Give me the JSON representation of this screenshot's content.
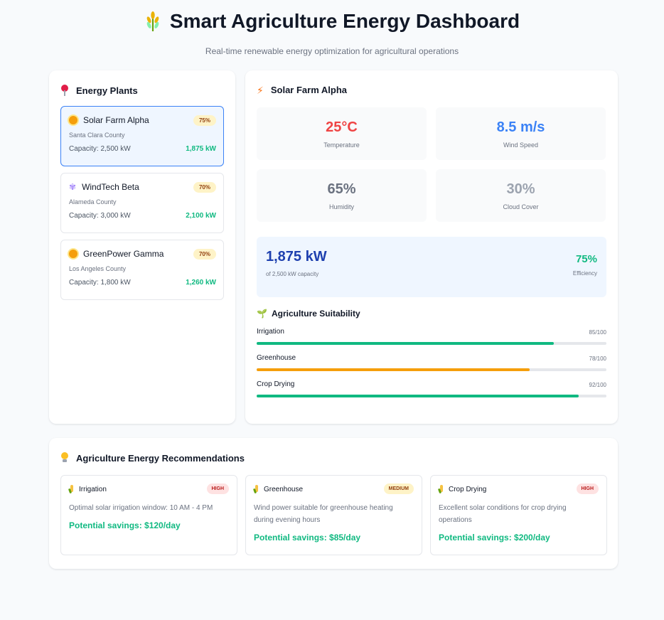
{
  "header": {
    "title": "Smart Agriculture Energy Dashboard",
    "subtitle": "Real-time renewable energy optimization for agricultural operations",
    "title_icon": "wheat-icon"
  },
  "plants": {
    "heading": "Energy Plants",
    "icon": "pin-icon",
    "items": [
      {
        "name": "Solar Farm Alpha",
        "county": "Santa Clara County",
        "capacity": "Capacity: 2,500 kW",
        "output": "1,875 kW",
        "efficiency": "75%",
        "icon": "sun-icon",
        "selected": true
      },
      {
        "name": "WindTech Beta",
        "county": "Alameda County",
        "capacity": "Capacity: 3,000 kW",
        "output": "2,100 kW",
        "efficiency": "70%",
        "icon": "wind-icon",
        "selected": false
      },
      {
        "name": "GreenPower Gamma",
        "county": "Los Angeles County",
        "capacity": "Capacity: 1,800 kW",
        "output": "1,260 kW",
        "efficiency": "70%",
        "icon": "sun-icon",
        "selected": false
      }
    ]
  },
  "detail": {
    "heading": "Solar Farm Alpha",
    "icon": "bolt-icon",
    "metrics": [
      {
        "value": "25°C",
        "label": "Temperature",
        "color": "#ef4444"
      },
      {
        "value": "8.5 m/s",
        "label": "Wind Speed",
        "color": "#3b82f6"
      },
      {
        "value": "65%",
        "label": "Humidity",
        "color": "#6b7280"
      },
      {
        "value": "30%",
        "label": "Cloud Cover",
        "color": "#9ca3af"
      }
    ],
    "output": {
      "value": "1,875 kW",
      "sub": "of 2,500 kW capacity",
      "efficiency": "75%",
      "efficiency_label": "Efficiency"
    },
    "suitability": {
      "heading": "Agriculture Suitability",
      "items": [
        {
          "name": "Irrigation",
          "score": "85/100",
          "fill": 0.85,
          "color": "#10b981"
        },
        {
          "name": "Greenhouse",
          "score": "78/100",
          "fill": 0.78,
          "color": "#f59e0b"
        },
        {
          "name": "Crop Drying",
          "score": "92/100",
          "fill": 0.92,
          "color": "#10b981"
        }
      ]
    }
  },
  "recommendations": {
    "heading": "Agriculture Energy Recommendations",
    "icon": "bulb-icon",
    "items": [
      {
        "name": "Irrigation",
        "priority": "HIGH",
        "desc": "Optimal solar irrigation window: 10 AM - 4 PM",
        "savings": "Potential savings: $120/day",
        "badge_bg": "#fee2e2",
        "badge_fg": "#b91c1c"
      },
      {
        "name": "Greenhouse",
        "priority": "MEDIUM",
        "desc": "Wind power suitable for greenhouse heating during evening hours",
        "savings": "Potential savings: $85/day",
        "badge_bg": "#fef3c7",
        "badge_fg": "#92400e"
      },
      {
        "name": "Crop Drying",
        "priority": "HIGH",
        "desc": "Excellent solar conditions for crop drying operations",
        "savings": "Potential savings: $200/day",
        "badge_bg": "#fee2e2",
        "badge_fg": "#b91c1c"
      }
    ]
  }
}
